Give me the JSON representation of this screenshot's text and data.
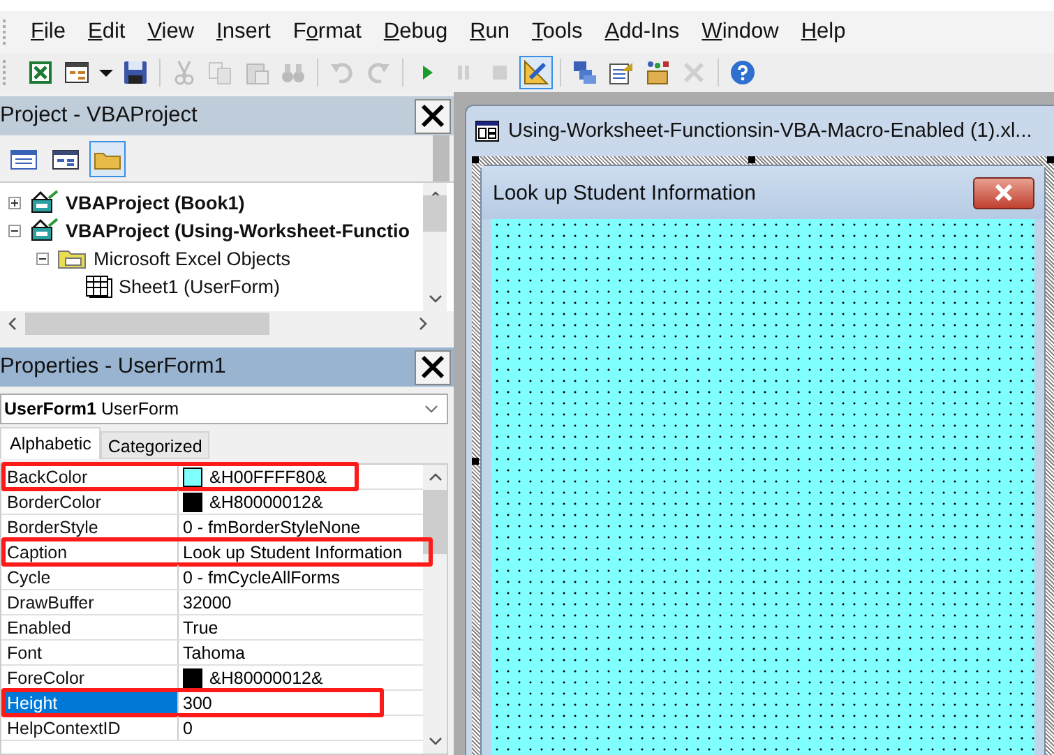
{
  "menu": [
    {
      "key": "F",
      "post": "ile"
    },
    {
      "key": "E",
      "post": "dit"
    },
    {
      "key": "V",
      "post": "iew"
    },
    {
      "key": "I",
      "post": "nsert"
    },
    {
      "pre": "F",
      "key": "o",
      "post": "rmat"
    },
    {
      "key": "D",
      "post": "ebug"
    },
    {
      "key": "R",
      "post": "un"
    },
    {
      "key": "T",
      "post": "ools"
    },
    {
      "key": "A",
      "post": "dd-Ins"
    },
    {
      "key": "W",
      "post": "indow"
    },
    {
      "key": "H",
      "post": "elp"
    }
  ],
  "toolbar": [
    {
      "kind": "excel",
      "disabled": false,
      "selected": false
    },
    {
      "kind": "insert-form",
      "disabled": false,
      "selected": false
    },
    {
      "kind": "dropdown",
      "disabled": false,
      "selected": false
    },
    {
      "kind": "save",
      "disabled": false,
      "selected": false
    },
    {
      "kind": "sep"
    },
    {
      "kind": "cut",
      "disabled": true,
      "selected": false
    },
    {
      "kind": "copy",
      "disabled": true,
      "selected": false
    },
    {
      "kind": "paste",
      "disabled": true,
      "selected": false
    },
    {
      "kind": "find",
      "disabled": true,
      "selected": false
    },
    {
      "kind": "sep"
    },
    {
      "kind": "undo",
      "disabled": true,
      "selected": false
    },
    {
      "kind": "redo",
      "disabled": true,
      "selected": false
    },
    {
      "kind": "sep"
    },
    {
      "kind": "run",
      "disabled": false,
      "selected": false
    },
    {
      "kind": "pause",
      "disabled": true,
      "selected": false
    },
    {
      "kind": "stop",
      "disabled": true,
      "selected": false
    },
    {
      "kind": "design",
      "disabled": false,
      "selected": true
    },
    {
      "kind": "sep"
    },
    {
      "kind": "explorer",
      "disabled": false,
      "selected": false
    },
    {
      "kind": "properties",
      "disabled": false,
      "selected": false
    },
    {
      "kind": "browser",
      "disabled": false,
      "selected": false
    },
    {
      "kind": "tools",
      "disabled": true,
      "selected": false
    },
    {
      "kind": "sep"
    },
    {
      "kind": "help",
      "disabled": false,
      "selected": false
    }
  ],
  "project_panel": {
    "title": "Project - VBAProject",
    "toolbar": [
      {
        "kind": "view-code",
        "selected": false
      },
      {
        "kind": "view-object",
        "selected": false
      },
      {
        "kind": "toggle-folders",
        "selected": true
      }
    ],
    "tree": [
      {
        "label": "VBAProject (Book1)",
        "kind": "project",
        "expanded": false
      },
      {
        "label": "VBAProject (Using-Worksheet-Functio",
        "kind": "project",
        "expanded": true,
        "children": [
          {
            "label": "Microsoft Excel Objects",
            "kind": "folder",
            "expanded": true,
            "children": [
              {
                "label": "Sheet1 (UserForm)",
                "kind": "sheet"
              }
            ]
          }
        ]
      }
    ]
  },
  "properties_panel": {
    "title": "Properties - UserForm1",
    "object": {
      "name": "UserForm1",
      "type": "UserForm"
    },
    "tabs": [
      {
        "label": "Alphabetic",
        "selected": true
      },
      {
        "label": "Categorized",
        "selected": false
      }
    ],
    "rows": [
      {
        "name": "BackColor",
        "value": "&H00FFFF80&",
        "color": "#80ffff",
        "selected": false,
        "highlighted": true
      },
      {
        "name": "BorderColor",
        "value": "&H80000012&",
        "color": "#000000",
        "selected": false,
        "highlighted": false
      },
      {
        "name": "BorderStyle",
        "value": "0 - fmBorderStyleNone",
        "selected": false,
        "highlighted": false
      },
      {
        "name": "Caption",
        "value": "Look up Student Information",
        "selected": false,
        "highlighted": true
      },
      {
        "name": "Cycle",
        "value": "0 - fmCycleAllForms",
        "selected": false,
        "highlighted": false
      },
      {
        "name": "DrawBuffer",
        "value": "32000",
        "selected": false,
        "highlighted": false
      },
      {
        "name": "Enabled",
        "value": "True",
        "selected": false,
        "highlighted": false
      },
      {
        "name": "Font",
        "value": "Tahoma",
        "selected": false,
        "highlighted": false
      },
      {
        "name": "ForeColor",
        "value": "&H80000012&",
        "color": "#000000",
        "selected": false,
        "highlighted": false
      },
      {
        "name": "Height",
        "value": "300",
        "selected": true,
        "highlighted": true
      },
      {
        "name": "HelpContextID",
        "value": "0",
        "selected": false,
        "highlighted": false
      }
    ]
  },
  "designer": {
    "title": "Using-Worksheet-Functionsin-VBA-Macro-Enabled (1).xl...",
    "form_caption": "Look up Student Information"
  }
}
